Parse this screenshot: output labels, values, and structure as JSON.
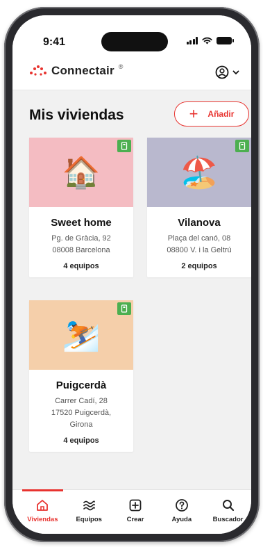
{
  "status_bar": {
    "time": "9:41"
  },
  "app": {
    "name": "Connectair",
    "registered_mark": "®",
    "brand_color": "#e8332f"
  },
  "page": {
    "title": "Mis viviendas"
  },
  "add_button": {
    "plus": "+",
    "label": "Añadir"
  },
  "homes": [
    {
      "name": "Sweet home",
      "address_lines": [
        "Pg. de Gràcia, 92",
        "08008 Barcelona"
      ],
      "devices": "4 equipos",
      "image_emoji": "🏠",
      "bg_color": "#f4bcc2",
      "status_color": "#4caf50"
    },
    {
      "name": "Vilanova",
      "address_lines": [
        "Plaça del canó, 08",
        "08800 V. i la Geltrú"
      ],
      "devices": "2 equipos",
      "image_emoji": "🏖️",
      "bg_color": "#b9b8ce",
      "status_color": "#4caf50"
    },
    {
      "name": "Puigcerdà",
      "address_lines": [
        "Carrer Cadí, 28",
        "17520 Puigcerdà,",
        "Girona"
      ],
      "devices": "4 equipos",
      "image_emoji": "⛷️",
      "bg_color": "#f5cfaa",
      "status_color": "#4caf50"
    }
  ],
  "bottom_nav": {
    "items": [
      {
        "label": "Viviendas",
        "icon": "home-icon",
        "active": true
      },
      {
        "label": "Equipos",
        "icon": "air-waves-icon",
        "active": false
      },
      {
        "label": "Crear",
        "icon": "add-box-icon",
        "active": false
      },
      {
        "label": "Ayuda",
        "icon": "help-icon",
        "active": false
      },
      {
        "label": "Buscador",
        "icon": "search-icon",
        "active": false
      }
    ]
  }
}
